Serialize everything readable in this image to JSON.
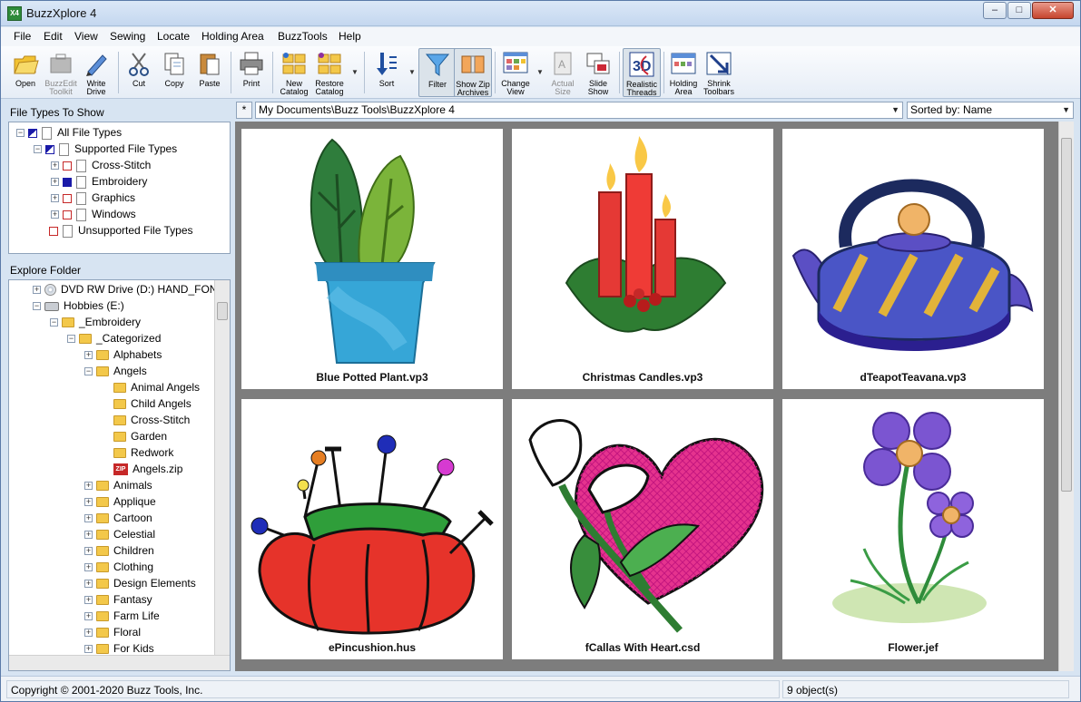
{
  "window": {
    "title": "BuzzXplore 4",
    "app_icon_text": "X4",
    "minimize": "‒",
    "maximize": "□",
    "close": "✕"
  },
  "menu": [
    "File",
    "Edit",
    "View",
    "Sewing",
    "Locate",
    "Holding Area",
    "BuzzTools",
    "Help"
  ],
  "toolbar": {
    "open": "Open",
    "buzzedit_1": "BuzzEdit",
    "buzzedit_2": "Toolkit",
    "write_1": "Write",
    "write_2": "Drive",
    "cut": "Cut",
    "copy": "Copy",
    "paste": "Paste",
    "print": "Print",
    "new_catalog_1": "New",
    "new_catalog_2": "Catalog",
    "restore_catalog_1": "Restore",
    "restore_catalog_2": "Catalog",
    "sort": "Sort",
    "filter": "Filter",
    "show_zip_1": "Show Zip",
    "show_zip_2": "Archives",
    "change_view_1": "Change",
    "change_view_2": "View",
    "actual_size_1": "Actual",
    "actual_size_2": "Size",
    "slide_show_1": "Slide",
    "slide_show_2": "Show",
    "realistic_1": "Realistic",
    "realistic_2": "Threads",
    "holding_1": "Holding",
    "holding_2": "Area",
    "shrink_1": "Shrink",
    "shrink_2": "Toolbars",
    "three_d_icon_text": "3D"
  },
  "file_types": {
    "heading": "File Types To Show",
    "items": [
      "All File Types",
      "Supported File Types",
      "Cross-Stitch",
      "Embroidery",
      "Graphics",
      "Windows",
      "Unsupported File Types"
    ]
  },
  "explore": {
    "heading": "Explore Folder",
    "zip_icon_text": "ZIP",
    "items": [
      "DVD RW Drive (D:) HAND_FON",
      "Hobbies (E:)",
      "_Embroidery",
      "_Categorized",
      "Alphabets",
      "Angels",
      "Animal Angels",
      "Child Angels",
      "Cross-Stitch",
      "Garden",
      "Redwork",
      "Angels.zip",
      "Animals",
      "Applique",
      "Cartoon",
      "Celestial",
      "Children",
      "Clothing",
      "Design Elements",
      "Fantasy",
      "Farm Life",
      "Floral",
      "For Kids"
    ]
  },
  "address": {
    "star": "*",
    "path": "My Documents\\Buzz Tools\\BuzzXplore 4",
    "sort_label": "Sorted by: Name"
  },
  "thumbnails": [
    {
      "caption": "Blue Potted Plant.vp3"
    },
    {
      "caption": "Christmas Candles.vp3"
    },
    {
      "caption": "dTeapotTeavana.vp3"
    },
    {
      "caption": "ePincushion.hus"
    },
    {
      "caption": "fCallas With Heart.csd"
    },
    {
      "caption": "Flower.jef"
    }
  ],
  "status": {
    "copyright": "Copyright © 2001-2020 Buzz Tools, Inc.",
    "count": "9 object(s)"
  }
}
